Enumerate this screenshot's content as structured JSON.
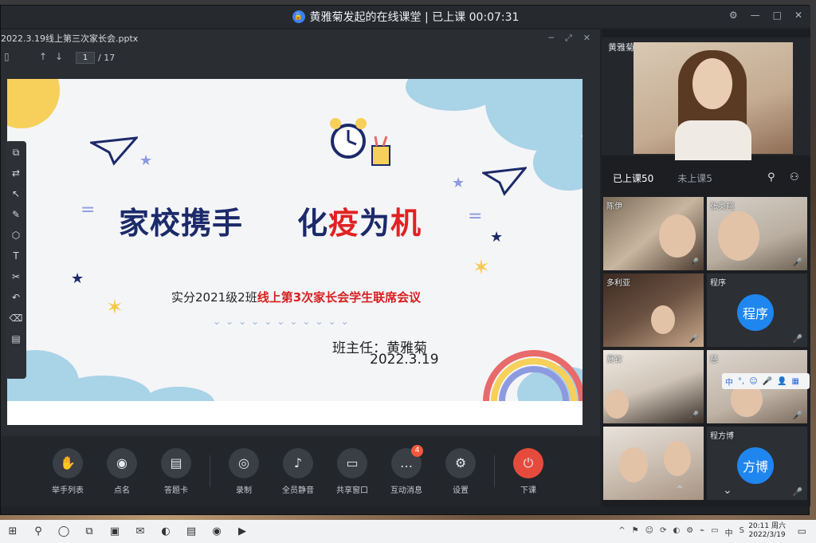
{
  "window": {
    "title": "黄雅菊发起的在线课堂 | 已上课 00:07:31",
    "lock_icon": "lock-icon",
    "controls": [
      "⚙",
      "—",
      "□",
      "✕"
    ]
  },
  "file": {
    "name": "2022.3.19线上第三次家长会.pptx",
    "page_current": "1",
    "page_total": "/ 17"
  },
  "slide": {
    "title_left": "家校携手",
    "title_right_a": "化",
    "title_right_b": "疫",
    "title_right_c": "为",
    "title_right_d": "机",
    "subtitle_a": "实分2021级2班",
    "subtitle_b": "线上第3次家长会学生联席会议",
    "teacher": "班主任：黄雅菊",
    "date": "2022.3.19",
    "chevrons": "⌄⌄⌄⌄⌄⌄⌄⌄⌄⌄⌄"
  },
  "tools": [
    "⧉",
    "⇄",
    "↖",
    "✎",
    "⬡",
    "T",
    "✂",
    "↶",
    "⌫",
    "▤"
  ],
  "controlbar": {
    "items": [
      {
        "label": "举手列表",
        "icon": "✋"
      },
      {
        "label": "点名",
        "icon": "◉"
      },
      {
        "label": "答题卡",
        "icon": "▤"
      },
      {
        "label": "录制",
        "icon": "◎"
      },
      {
        "label": "全员静音",
        "icon": "♪"
      },
      {
        "label": "共享窗口",
        "icon": "▭"
      },
      {
        "label": "互动消息",
        "icon": "…",
        "badge": "4"
      },
      {
        "label": "设置",
        "icon": "⚙"
      },
      {
        "label": "下课",
        "icon": "⏻"
      }
    ]
  },
  "teacher_video": {
    "name": "黄雅菊"
  },
  "tabs": {
    "in_class": "已上课50",
    "not_in_class": "未上课5"
  },
  "students": [
    {
      "name": "陈伊",
      "mic": "🎤"
    },
    {
      "name": "张奥翔",
      "mic": "🎤"
    },
    {
      "name": "多利亚",
      "mic": "🎤"
    },
    {
      "name": "程序",
      "avatar": "程序",
      "mic": "🎤"
    },
    {
      "name": "夏钦",
      "mic": "🎤"
    },
    {
      "name": "慈",
      "mic": "🎤"
    },
    {
      "name": "",
      "mic": ""
    },
    {
      "name": "程方博",
      "avatar": "方博",
      "mic": "🎤"
    }
  ],
  "ime": {
    "items": [
      "中",
      "°,",
      "☺",
      "🎤",
      "👤",
      "▦"
    ]
  },
  "taskbar": {
    "time": "20:11 周六",
    "date": "2022/3/19",
    "apps": [
      "⊞",
      "⚲",
      "◯",
      "⧉",
      "▣",
      "✉",
      "◐",
      "▤",
      "◉",
      "▶"
    ],
    "tray": [
      "^",
      "⚑",
      "☺",
      "⟳",
      "◐",
      "⚙",
      "⌁",
      "▭",
      "中",
      "S"
    ]
  },
  "colors": {
    "accent_blue": "#1f86f0",
    "end_red": "#e54b3c",
    "title_navy": "#1c2a6a",
    "title_red": "#e02222"
  }
}
